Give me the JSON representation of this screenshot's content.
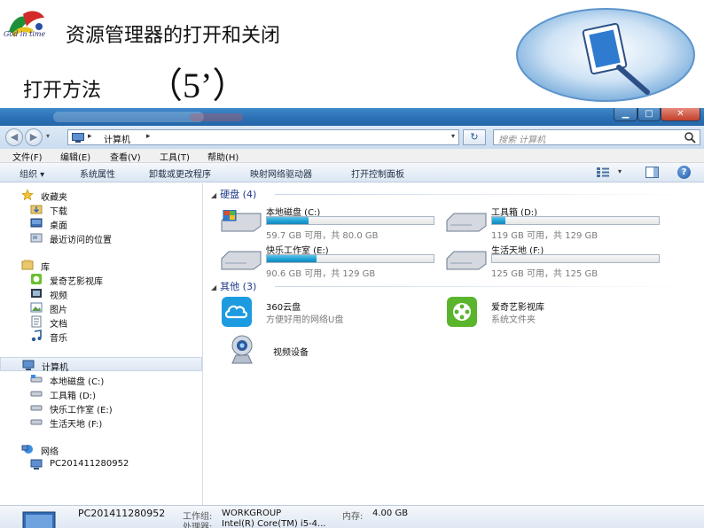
{
  "slide": {
    "title": "资源管理器的打开和关闭",
    "subtitle": "打开方法",
    "note": "（5’）",
    "logo_text": "God in time"
  },
  "window": {
    "breadcrumb": "计算机",
    "search_placeholder": "搜索 计算机",
    "menu": [
      "文件(F)",
      "编辑(E)",
      "查看(V)",
      "工具(T)",
      "帮助(H)"
    ],
    "toolbar": [
      "组织 ▾",
      "系统属性",
      "卸载或更改程序",
      "映射网络驱动器",
      "打开控制面板"
    ],
    "nav": {
      "favorites_label": "收藏夹",
      "favorites": [
        "下载",
        "桌面",
        "最近访问的位置"
      ],
      "libraries_label": "库",
      "libraries": [
        "爱奇艺影视库",
        "视频",
        "图片",
        "文档",
        "音乐"
      ],
      "computer_label": "计算机",
      "computer_items": [
        "本地磁盘 (C:)",
        "工具箱 (D:)",
        "快乐工作室 (E:)",
        "生活天地 (F:)"
      ],
      "network_label": "网络",
      "network_items": [
        "PC201411280952"
      ]
    },
    "groups": {
      "hard_disks": "硬盘 (4)",
      "others": "其他 (3)"
    },
    "drives": [
      {
        "name": "本地磁盘 (C:)",
        "free": "59.7 GB 可用，共 80.0 GB",
        "used_fraction": 0.25
      },
      {
        "name": "工具箱 (D:)",
        "free": "119 GB 可用，共 129 GB",
        "used_fraction": 0.08
      },
      {
        "name": "快乐工作室 (E:)",
        "free": "90.6 GB 可用，共 129 GB",
        "used_fraction": 0.3
      },
      {
        "name": "生活天地 (F:)",
        "free": "125 GB 可用，共 125 GB",
        "used_fraction": 0.0
      }
    ],
    "devices": [
      {
        "name": "360云盘",
        "desc": "方便好用的网络U盘",
        "icon": "cloud-drive-icon"
      },
      {
        "name": "爱奇艺影视库",
        "desc": "系统文件夹",
        "icon": "iqiyi-library-icon"
      },
      {
        "name": "视频设备",
        "desc": "",
        "icon": "webcam-icon"
      }
    ],
    "details": {
      "computer_name": "PC201411280952",
      "workgroup_label": "工作组:",
      "workgroup": "WORKGROUP",
      "memory_label": "内存:",
      "memory": "4.00 GB",
      "processor_label": "处理器:",
      "processor": "Intel(R) Core(TM) i5-4..."
    }
  },
  "colors": {
    "title_bar": "#2a6fb4",
    "drive_fill": "#1ea0d4",
    "group_header": "#1e3a8a"
  }
}
